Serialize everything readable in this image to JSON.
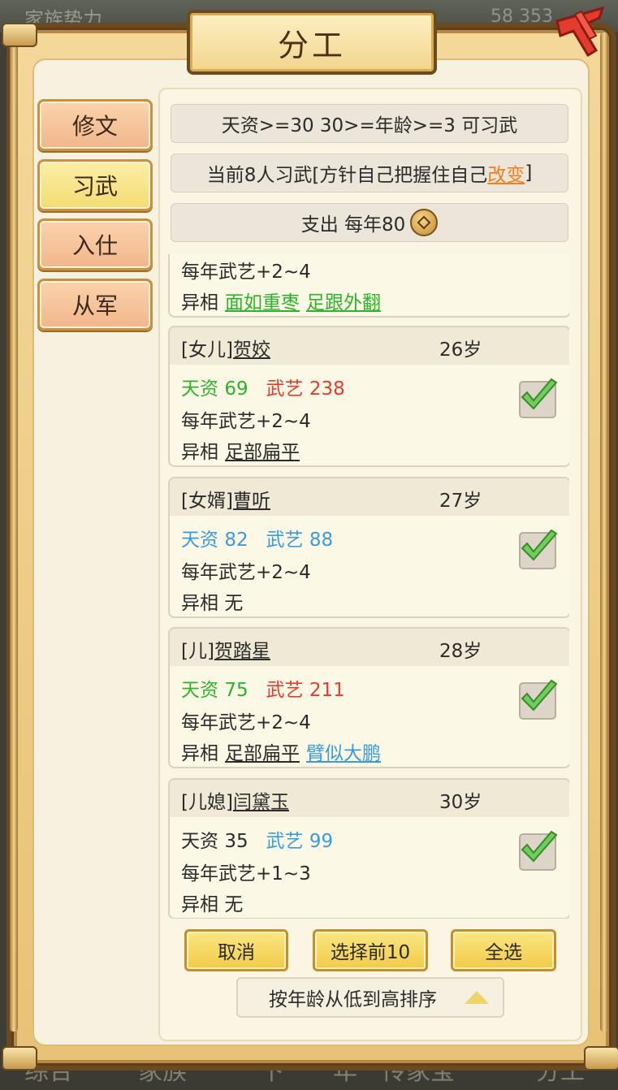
{
  "background": {
    "top_left": "家族势力",
    "top_right": "58 353",
    "bottom_tabs": [
      "综合",
      "家族",
      "下",
      "年",
      "传家宝",
      "分工"
    ]
  },
  "title": "分工",
  "side_tabs": [
    {
      "label": "修文",
      "active": false
    },
    {
      "label": "习武",
      "active": true
    },
    {
      "label": "入仕",
      "active": false
    },
    {
      "label": "从军",
      "active": false
    }
  ],
  "info": {
    "requirement": "天资>=30 30>=年龄>=3 可习武",
    "current_prefix": "当前8人习武[方针自己把握住自己",
    "current_link": "改变",
    "current_suffix": "]",
    "expense": "支出 每年80"
  },
  "partial_card": {
    "growth": "每年武艺+2~4",
    "trait_label": "异相",
    "traits": [
      "面如重枣",
      "足跟外翻"
    ]
  },
  "members": [
    {
      "relation": "[女儿]",
      "name": "贺姣",
      "age": "26岁",
      "talent_label": "天资",
      "talent": "69",
      "martial_label": "武艺",
      "martial": "238",
      "talent_color": "g",
      "martial_color": "r",
      "growth": "每年武艺+2~4",
      "trait_label": "异相",
      "traits": [
        "足部扁平"
      ],
      "trait_colors": [
        "k"
      ],
      "checked": true
    },
    {
      "relation": "[女婿]",
      "name": "曹听",
      "age": "27岁",
      "talent_label": "天资",
      "talent": "82",
      "martial_label": "武艺",
      "martial": "88",
      "talent_color": "b",
      "martial_color": "b",
      "growth": "每年武艺+2~4",
      "trait_label": "异相",
      "traits": [
        "无"
      ],
      "trait_colors": [
        "plain"
      ],
      "checked": true
    },
    {
      "relation": "[儿]",
      "name": "贺踏星",
      "age": "28岁",
      "talent_label": "天资",
      "talent": "75",
      "martial_label": "武艺",
      "martial": "211",
      "talent_color": "g",
      "martial_color": "r",
      "growth": "每年武艺+2~4",
      "trait_label": "异相",
      "traits": [
        "足部扁平",
        "臂似大鹏"
      ],
      "trait_colors": [
        "k",
        "b"
      ],
      "checked": true
    },
    {
      "relation": "[儿媳]",
      "name": "闫黛玉",
      "age": "30岁",
      "talent_label": "天资",
      "talent": "35",
      "martial_label": "武艺",
      "martial": "99",
      "talent_color": "k",
      "martial_color": "b",
      "growth": "每年武艺+1~3",
      "trait_label": "异相",
      "traits": [
        "无"
      ],
      "trait_colors": [
        "plain"
      ],
      "checked": true
    }
  ],
  "buttons": {
    "cancel": "取消",
    "select_top10": "选择前10",
    "select_all": "全选",
    "sort": "按年龄从低到高排序"
  },
  "colors": {
    "green": "#2bb52b",
    "red": "#e63c2f",
    "blue": "#3a9be0",
    "orange_link": "#f07f21",
    "gold_button": "#f1cb48"
  }
}
